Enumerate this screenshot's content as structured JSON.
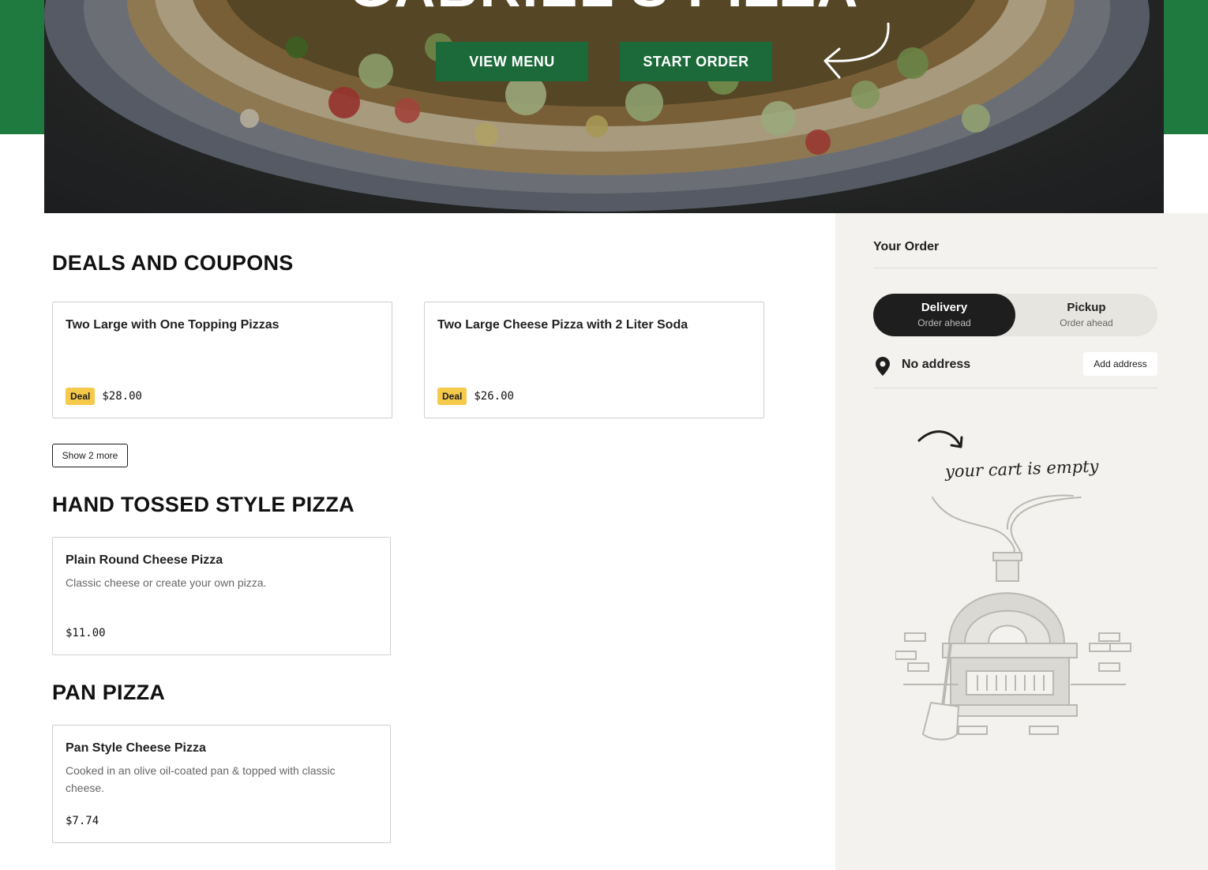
{
  "hero": {
    "title": "GABRIEL'S PIZZA",
    "view_menu_label": "VIEW MENU",
    "start_order_label": "START ORDER"
  },
  "sections": {
    "deals": {
      "title": "DEALS AND COUPONS",
      "items": [
        {
          "name": "Two Large with One Topping Pizzas",
          "badge": "Deal",
          "price": "$28.00"
        },
        {
          "name": "Two Large Cheese Pizza with 2 Liter Soda",
          "badge": "Deal",
          "price": "$26.00"
        }
      ],
      "show_more_label": "Show 2 more"
    },
    "hand_tossed": {
      "title": "HAND TOSSED STYLE PIZZA",
      "items": [
        {
          "name": "Plain Round Cheese Pizza",
          "description": "Classic cheese or create your own pizza.",
          "price": "$11.00"
        }
      ]
    },
    "pan": {
      "title": "PAN PIZZA",
      "items": [
        {
          "name": "Pan Style Cheese Pizza",
          "description": "Cooked in an olive oil-coated pan & topped with classic cheese.",
          "price": "$7.74"
        }
      ]
    }
  },
  "sidebar": {
    "title": "Your Order",
    "modes": [
      {
        "label": "Delivery",
        "sub": "Order ahead",
        "active": true
      },
      {
        "label": "Pickup",
        "sub": "Order ahead",
        "active": false
      }
    ],
    "address_text": "No address",
    "add_address_label": "Add address",
    "empty_cart_text": "your cart is empty"
  },
  "colors": {
    "brand_green": "#1f7a3f",
    "button_green": "#1c6a3a",
    "deal_badge": "#f5c94a",
    "sidebar_bg": "#f3f2ee"
  },
  "icons": [
    "curved-arrow-icon",
    "map-pin-icon",
    "squiggle-arrow-icon",
    "pizza-oven-illustration"
  ]
}
